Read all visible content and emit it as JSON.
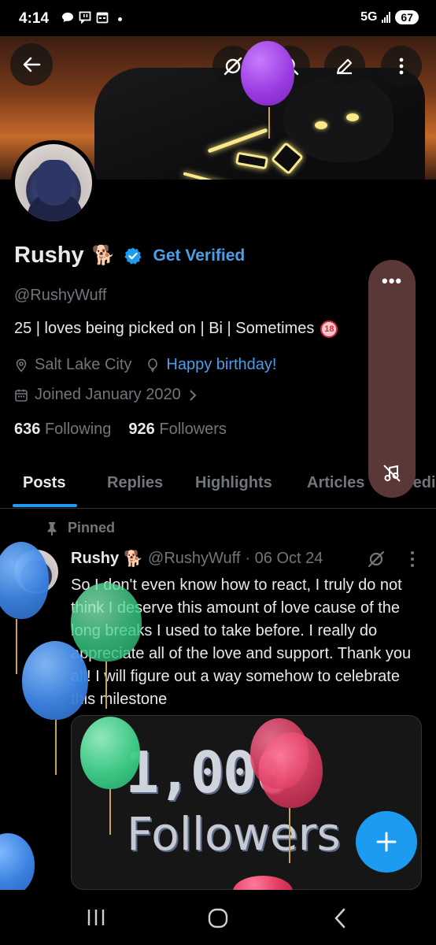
{
  "status_bar": {
    "time": "4:14",
    "network": "5G",
    "battery": "67"
  },
  "profile": {
    "name": "Rushy",
    "name_emoji": "🐕",
    "get_verified": "Get Verified",
    "handle": "@RushyWuff",
    "bio_text": "25 | loves being picked on | Bi | Sometimes",
    "bio_badge": "18",
    "location": "Salt Lake City",
    "birthday_link": "Happy birthday!",
    "joined": "Joined January 2020",
    "following_count": "636",
    "following_label": "Following",
    "followers_count": "926",
    "followers_label": "Followers"
  },
  "tabs": [
    {
      "label": "Posts"
    },
    {
      "label": "Replies"
    },
    {
      "label": "Highlights"
    },
    {
      "label": "Articles"
    },
    {
      "label": "Media"
    }
  ],
  "pinned_tweet": {
    "pinned_label": "Pinned",
    "author_name": "Rushy",
    "author_emoji": "🐕",
    "author_handle": "@RushyWuff",
    "date": "· 06 Oct 24",
    "text": "So I don't even know how to react, I truly do not think I deserve this amount of love cause of the long breaks I used to take before. I really do appreciate all of the love and support. Thank you all! I will figure out a way somehow to celebrate this milestone",
    "media_line1": "1,000",
    "media_line2": "Followers"
  },
  "icons": {
    "back": "arrow-left-icon",
    "grok": "grok-icon",
    "search": "search-icon",
    "edit": "edit-icon",
    "more": "more-vertical-icon",
    "location": "location-pin-icon",
    "balloon": "balloon-icon",
    "calendar": "calendar-icon",
    "pin": "pin-icon",
    "fab": "plus-icon"
  },
  "colors": {
    "accent": "#1d9bf0",
    "link": "#4b9ee8",
    "muted": "#71767b",
    "background": "#000000"
  }
}
